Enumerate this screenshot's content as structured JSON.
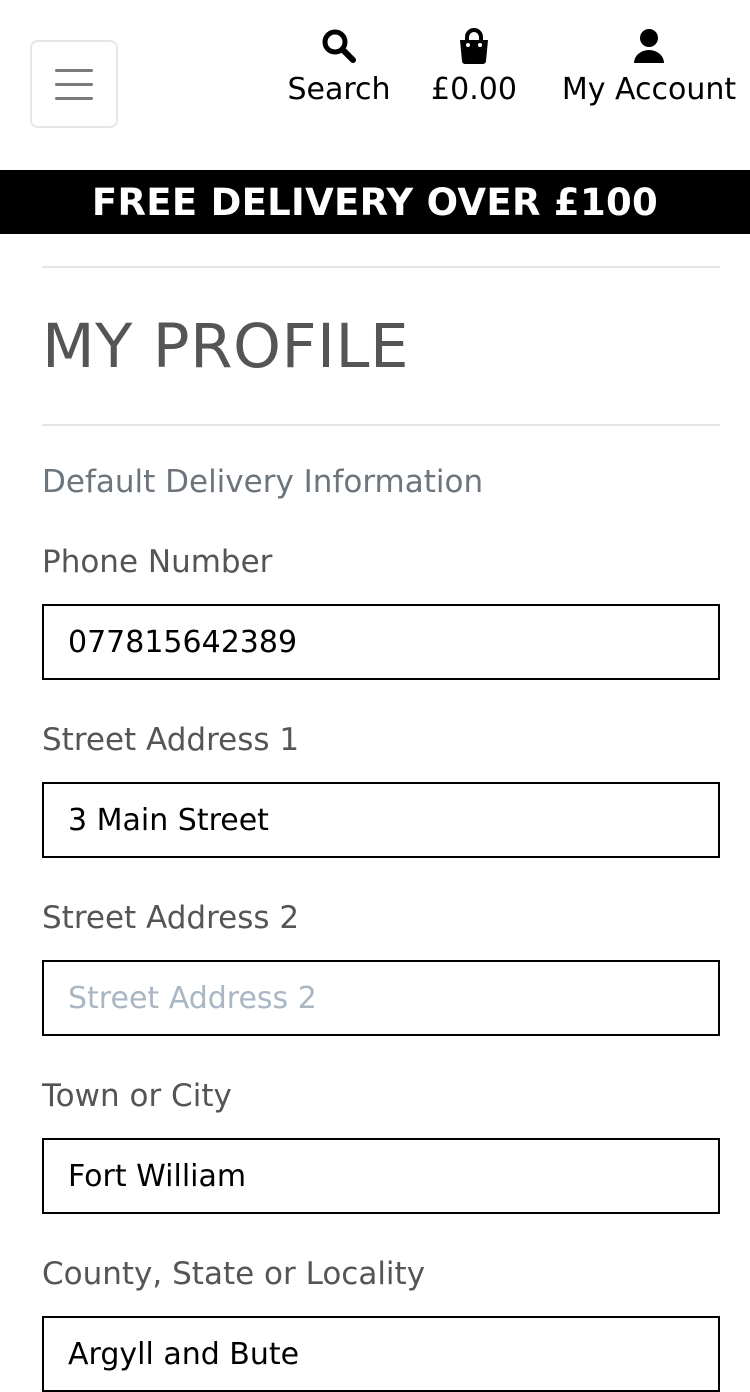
{
  "header": {
    "menu_toggle_label": "",
    "search_label": "Search",
    "bag_total": "£0.00",
    "account_label": "My Account"
  },
  "banner": {
    "text": "FREE DELIVERY OVER £100"
  },
  "profile": {
    "title": "MY PROFILE",
    "section_heading": "Default Delivery Information",
    "fields": [
      {
        "label": "Phone Number",
        "value": "077815642389",
        "placeholder": "Phone Number"
      },
      {
        "label": "Street Address 1",
        "value": "3 Main Street",
        "placeholder": "Street Address 1"
      },
      {
        "label": "Street Address 2",
        "value": "",
        "placeholder": "Street Address 2"
      },
      {
        "label": "Town or City",
        "value": "Fort William",
        "placeholder": "Town or City"
      },
      {
        "label": "County, State or Locality",
        "value": "Argyll and Bute",
        "placeholder": "County, State or Locality"
      }
    ]
  },
  "icons": {
    "menu": "hamburger-icon",
    "search": "search-icon",
    "bag": "shopping-bag-icon",
    "account": "user-icon"
  },
  "colors": {
    "banner_bg": "#000000",
    "banner_text": "#ffffff",
    "title": "#555555",
    "muted_heading": "#6c757d",
    "placeholder": "#a9b6c3"
  }
}
